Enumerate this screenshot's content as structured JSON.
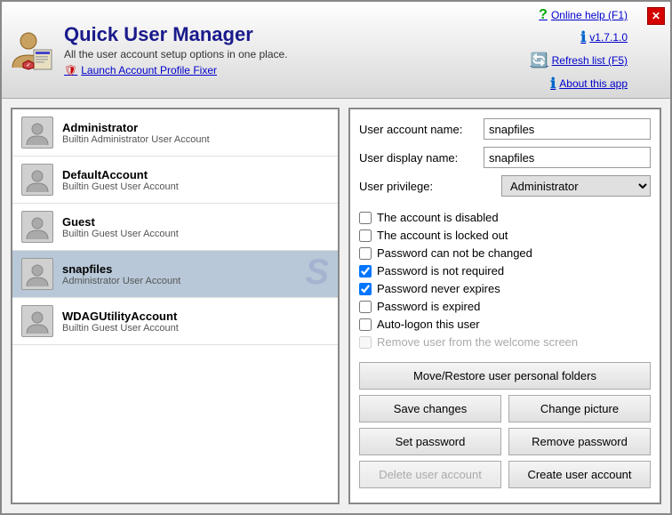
{
  "window": {
    "title": "Quick User Manager",
    "subtitle": "All the user account setup options in one place.",
    "launch_link": "Launch Account Profile Fixer",
    "close_label": "✕",
    "version": "v1.7.1.0",
    "online_help": "Online help (F1)",
    "refresh_list": "Refresh list (F5)",
    "about": "About this app"
  },
  "users": [
    {
      "name": "Administrator",
      "desc": "Builtin Administrator User Account",
      "selected": false
    },
    {
      "name": "DefaultAccount",
      "desc": "Builtin Guest User Account",
      "selected": false
    },
    {
      "name": "Guest",
      "desc": "Builtin Guest User Account",
      "selected": false
    },
    {
      "name": "snapfiles",
      "desc": "Administrator User Account",
      "selected": true
    },
    {
      "name": "WDAGUtilityAccount",
      "desc": "Builtin Guest User Account",
      "selected": false
    }
  ],
  "form": {
    "account_name_label": "User account name:",
    "account_name_value": "snapfiles",
    "display_name_label": "User display name:",
    "display_name_value": "snapfiles",
    "privilege_label": "User privilege:",
    "privilege_value": "Administrator"
  },
  "checkboxes": [
    {
      "label": "The account is disabled",
      "checked": false,
      "disabled": false
    },
    {
      "label": "The account is locked out",
      "checked": false,
      "disabled": false
    },
    {
      "label": "Password can not be changed",
      "checked": false,
      "disabled": false
    },
    {
      "label": "Password is not required",
      "checked": true,
      "disabled": false
    },
    {
      "label": "Password never expires",
      "checked": true,
      "disabled": false
    },
    {
      "label": "Password is expired",
      "checked": false,
      "disabled": false
    },
    {
      "label": "Auto-logon this user",
      "checked": false,
      "disabled": false
    },
    {
      "label": "Remove user from the welcome screen",
      "checked": false,
      "disabled": true
    }
  ],
  "buttons": {
    "move_restore": "Move/Restore user personal folders",
    "save_changes": "Save changes",
    "change_picture": "Change picture",
    "set_password": "Set password",
    "remove_password": "Remove password",
    "delete_account": "Delete user account",
    "create_account": "Create user account"
  }
}
